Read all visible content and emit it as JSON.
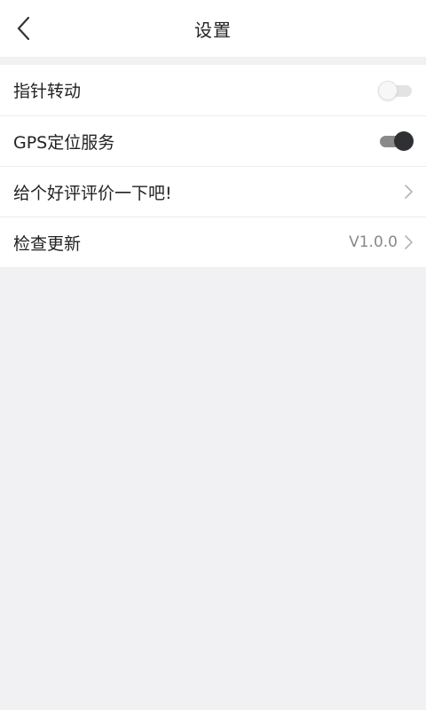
{
  "header": {
    "title": "设置",
    "back_icon": "chevron-left-icon"
  },
  "settings": {
    "pointer_rotation": {
      "label": "指针转动",
      "enabled": false
    },
    "gps_service": {
      "label": "GPS定位服务",
      "enabled": true
    },
    "rate_app": {
      "label": "给个好评评价一下吧!",
      "icon": "chevron-right-icon"
    },
    "check_update": {
      "label": "检查更新",
      "version": "V1.0.0",
      "icon": "chevron-right-icon"
    }
  },
  "colors": {
    "background": "#f1f0f2",
    "switch_on_knob": "#2f3034",
    "switch_on_track": "#8a8a8a",
    "switch_off_track": "#e3e3e3"
  }
}
